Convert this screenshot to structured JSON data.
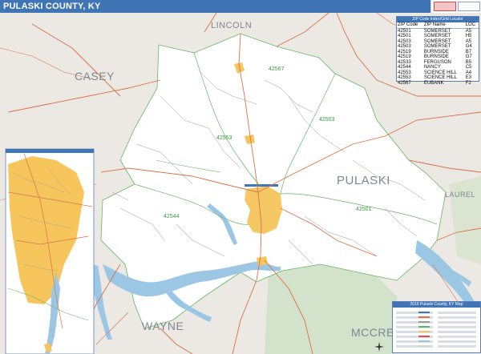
{
  "header": {
    "title": "PULASKI COUNTY, KY"
  },
  "map": {
    "region_labels": {
      "lincoln": "LINCOLN",
      "casey": "CASEY",
      "pulaski": "PULASKI",
      "laurel": "LAUREL",
      "wayne": "WAYNE",
      "mccreary": "MCCREA"
    },
    "zip_labels": {
      "z42567": "42567",
      "z42503": "42503",
      "z42544": "42544",
      "z42501": "42501",
      "z42553": "42553"
    },
    "colors": {
      "county_fill": "#ffffff",
      "outside_fill": "#ece8e3",
      "water": "#9bc7e4",
      "city": "#f6c55c",
      "primary_roads": "#d9734a",
      "zip_boundary": "#5fb85f",
      "forest": "#c9dfc0",
      "header": "#3f74b5"
    }
  },
  "zip_table": {
    "title": "ZIP Code Index/Grid Locator",
    "headers": [
      "ZIP Code",
      "ZIP Name",
      "LOC"
    ],
    "rows": [
      [
        "42501",
        "SOMERSET",
        "A5"
      ],
      [
        "42501",
        "SOMERSET",
        "H5"
      ],
      [
        "42503",
        "SOMERSET",
        "A5"
      ],
      [
        "42503",
        "SOMERSET",
        "G4"
      ],
      [
        "42519",
        "BURNSIDE",
        "B7"
      ],
      [
        "42519",
        "BURNSIDE",
        "G7"
      ],
      [
        "42533",
        "FERGUSON",
        "B5"
      ],
      [
        "42544",
        "NANCY",
        "C5"
      ],
      [
        "42553",
        "SCIENCE HILL",
        "A4"
      ],
      [
        "42553",
        "SCIENCE HILL",
        "E3"
      ],
      [
        "42567",
        "EUBANK",
        "F2"
      ]
    ]
  },
  "legend": {
    "title": "2016 Pulaski County, KY Map"
  }
}
